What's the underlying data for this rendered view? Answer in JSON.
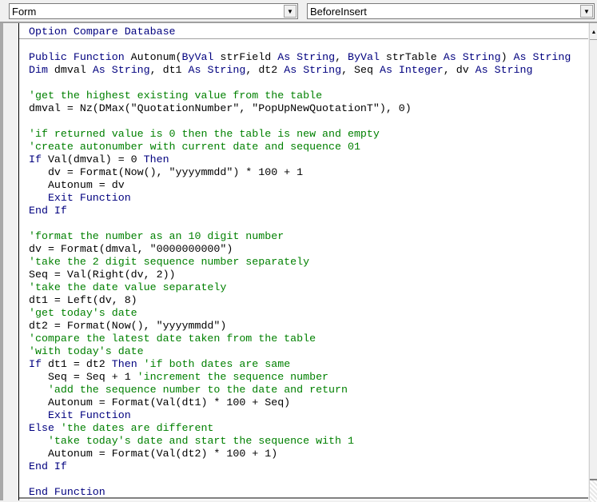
{
  "toolbar": {
    "object_combo": "Form",
    "procedure_combo": "BeforeInsert"
  },
  "colors": {
    "keyword": "#00007f",
    "comment": "#008000",
    "text": "#000000"
  },
  "code": {
    "declarations": [
      [
        [
          "k",
          "Option Compare Database"
        ]
      ]
    ],
    "lines": [
      [],
      [
        [
          "k",
          "Public Function "
        ],
        [
          "t",
          "Autonum("
        ],
        [
          "k",
          "ByVal "
        ],
        [
          "t",
          "strField "
        ],
        [
          "k",
          "As String"
        ],
        [
          "t",
          ", "
        ],
        [
          "k",
          "ByVal "
        ],
        [
          "t",
          "strTable "
        ],
        [
          "k",
          "As String"
        ],
        [
          "t",
          ") "
        ],
        [
          "k",
          "As String"
        ]
      ],
      [
        [
          "k",
          "Dim "
        ],
        [
          "t",
          "dmval "
        ],
        [
          "k",
          "As String"
        ],
        [
          "t",
          ", dt1 "
        ],
        [
          "k",
          "As String"
        ],
        [
          "t",
          ", dt2 "
        ],
        [
          "k",
          "As String"
        ],
        [
          "t",
          ", Seq "
        ],
        [
          "k",
          "As Integer"
        ],
        [
          "t",
          ", dv "
        ],
        [
          "k",
          "As String"
        ]
      ],
      [],
      [
        [
          "c",
          "'get the highest existing value from the table"
        ]
      ],
      [
        [
          "t",
          "dmval = Nz(DMax(\"QuotationNumber\", \"PopUpNewQuotationT\"), 0)"
        ]
      ],
      [],
      [
        [
          "c",
          "'if returned value is 0 then the table is new and empty"
        ]
      ],
      [
        [
          "c",
          "'create autonumber with current date and sequence 01"
        ]
      ],
      [
        [
          "k",
          "If "
        ],
        [
          "t",
          "Val(dmval) = 0 "
        ],
        [
          "k",
          "Then"
        ]
      ],
      [
        [
          "t",
          "   dv = Format(Now(), \"yyyymmdd\") * 100 + 1"
        ]
      ],
      [
        [
          "t",
          "   Autonum = dv"
        ]
      ],
      [
        [
          "t",
          "   "
        ],
        [
          "k",
          "Exit Function"
        ]
      ],
      [
        [
          "k",
          "End If"
        ]
      ],
      [],
      [
        [
          "c",
          "'format the number as an 10 digit number"
        ]
      ],
      [
        [
          "t",
          "dv = Format(dmval, \"0000000000\")"
        ]
      ],
      [
        [
          "c",
          "'take the 2 digit sequence number separately"
        ]
      ],
      [
        [
          "t",
          "Seq = Val(Right(dv, 2))"
        ]
      ],
      [
        [
          "c",
          "'take the date value separately"
        ]
      ],
      [
        [
          "t",
          "dt1 = Left(dv, 8)"
        ]
      ],
      [
        [
          "c",
          "'get today's date"
        ]
      ],
      [
        [
          "t",
          "dt2 = Format(Now(), \"yyyymmdd\")"
        ]
      ],
      [
        [
          "c",
          "'compare the latest date taken from the table"
        ]
      ],
      [
        [
          "c",
          "'with today's date"
        ]
      ],
      [
        [
          "k",
          "If "
        ],
        [
          "t",
          "dt1 = dt2 "
        ],
        [
          "k",
          "Then "
        ],
        [
          "c",
          "'if both dates are same"
        ]
      ],
      [
        [
          "t",
          "   Seq = Seq + 1 "
        ],
        [
          "c",
          "'increment the sequence number"
        ]
      ],
      [
        [
          "t",
          "   "
        ],
        [
          "c",
          "'add the sequence number to the date and return"
        ]
      ],
      [
        [
          "t",
          "   Autonum = Format(Val(dt1) * 100 + Seq)"
        ]
      ],
      [
        [
          "t",
          "   "
        ],
        [
          "k",
          "Exit Function"
        ]
      ],
      [
        [
          "k",
          "Else "
        ],
        [
          "c",
          "'the dates are different"
        ]
      ],
      [
        [
          "t",
          "   "
        ],
        [
          "c",
          "'take today's date and start the sequence with 1"
        ]
      ],
      [
        [
          "t",
          "   Autonum = Format(Val(dt2) * 100 + 1)"
        ]
      ],
      [
        [
          "k",
          "End If"
        ]
      ],
      [],
      [
        [
          "k",
          "End Function"
        ]
      ]
    ]
  }
}
